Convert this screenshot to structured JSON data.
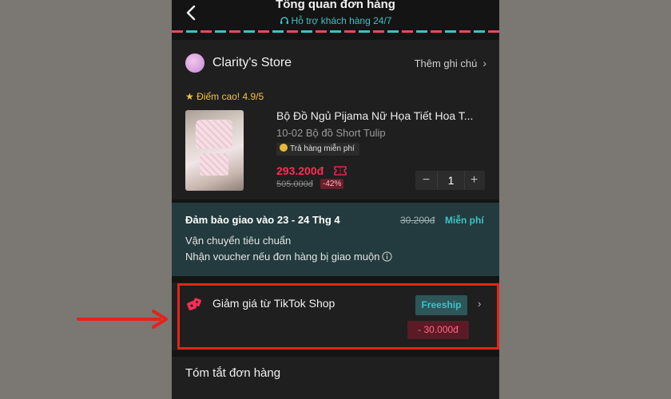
{
  "header": {
    "title": "Tổng quan đơn hàng",
    "support": "Hỗ trợ khách hàng 24/7"
  },
  "store": {
    "name": "Clarity's Store",
    "add_note": "Thêm ghi chú",
    "rating": "Điểm cao! 4.9/5"
  },
  "product": {
    "title": "Bộ Đồ Ngủ Pijama Nữ Họa Tiết Hoa T...",
    "variant": "10-02 Bộ đồ Short Tulip",
    "return_badge": "Trả hàng miễn phí",
    "price": "293.200đ",
    "original_price": "505.000đ",
    "discount_pct": "-42%",
    "quantity": "1",
    "minus": "−",
    "plus": "+"
  },
  "shipping": {
    "guarantee": "Đảm bảo giao vào 23 - 24 Thg 4",
    "old_fee": "30.200đ",
    "free": "Miễn phí",
    "method": "Vận chuyển tiêu chuẩn",
    "voucher_note": "Nhận voucher nếu đơn hàng bị giao muộn"
  },
  "discount": {
    "label": "Giảm giá từ TikTok Shop",
    "badge": "Freeship",
    "amount": "- 30.000đ"
  },
  "summary": {
    "title": "Tóm tắt đơn hàng"
  },
  "colors": {
    "accent_red": "#fe2c55",
    "accent_teal": "#3ec1c6",
    "highlight": "#e3231a"
  },
  "icons": [
    "back-chevron-icon",
    "headset-icon",
    "store-avatar",
    "star-icon",
    "coin-icon",
    "ticket-icon",
    "info-icon",
    "tiktok-shop-discount-icon",
    "chevron-right-icon",
    "red-arrow-pointer"
  ]
}
